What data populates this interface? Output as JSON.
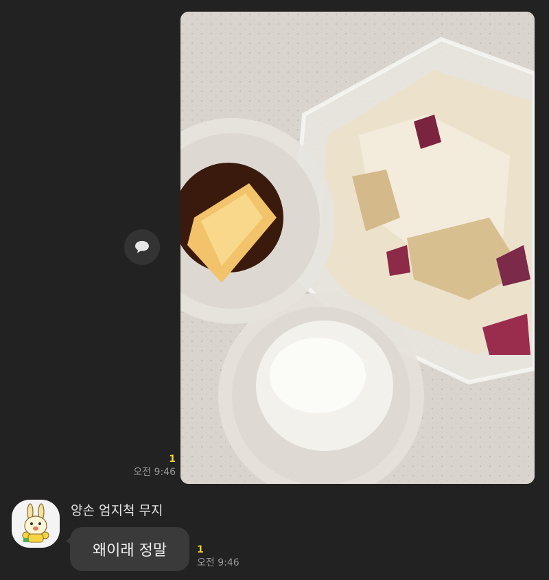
{
  "outgoing": {
    "unread_count": "1",
    "time": "오전 9:46",
    "image_icon": "photo-message"
  },
  "share_button": {
    "icon": "speech-bubble-icon"
  },
  "incoming": {
    "sender_name": "양손 엄지척 무지",
    "avatar_icon": "rabbit-character-avatar",
    "message": "왜이래 정말",
    "unread_count": "1",
    "time": "오전 9:46"
  },
  "colors": {
    "background": "#222222",
    "bubble": "#3a3a3a",
    "unread": "#f2d12e",
    "time": "#9a9a9a"
  }
}
